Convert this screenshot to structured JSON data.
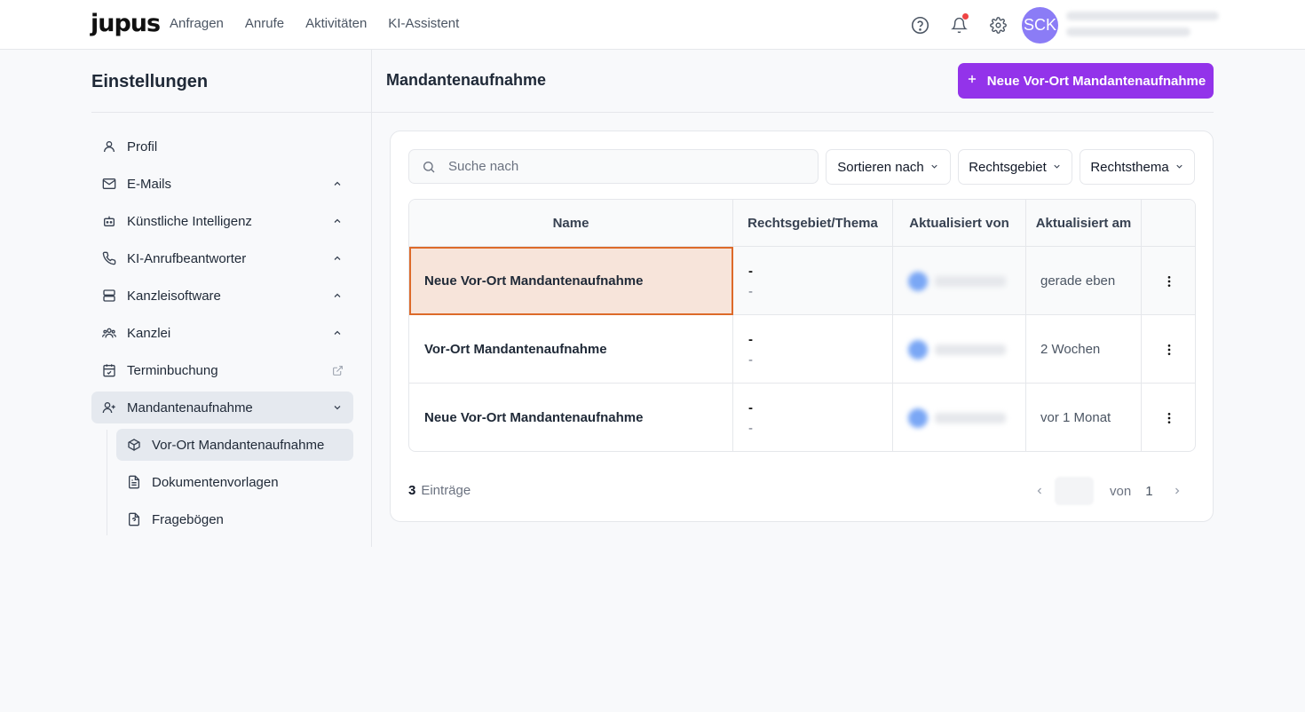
{
  "app": {
    "logo": "jupus"
  },
  "nav": {
    "items": [
      "Anfragen",
      "Anrufe",
      "Aktivitäten",
      "KI-Assistent"
    ]
  },
  "header": {
    "avatar_initials": "SCK"
  },
  "sidebar": {
    "title": "Einstellungen",
    "items": [
      {
        "label": "Profil",
        "icon": "user-icon"
      },
      {
        "label": "E-Mails",
        "icon": "mail-icon"
      },
      {
        "label": "Künstliche Intelligenz",
        "icon": "bot-icon"
      },
      {
        "label": "KI-Anrufbeantworter",
        "icon": "phone-icon"
      },
      {
        "label": "Kanzleisoftware",
        "icon": "server-icon"
      },
      {
        "label": "Kanzlei",
        "icon": "users-icon"
      },
      {
        "label": "Terminbuchung",
        "icon": "calendar-check-icon"
      },
      {
        "label": "Mandantenaufnahme",
        "icon": "user-plus-icon"
      }
    ],
    "subitems": [
      {
        "label": "Vor-Ort Mandantenaufnahme",
        "icon": "box-icon"
      },
      {
        "label": "Dokumentenvorlagen",
        "icon": "file-text-icon"
      },
      {
        "label": "Fragebögen",
        "icon": "file-question-icon"
      }
    ]
  },
  "main": {
    "title": "Mandantenaufnahme",
    "new_button_label": "Neue Vor-Ort Mandantenaufnahme",
    "search_placeholder": "Suche nach",
    "filters": [
      "Sortieren nach",
      "Rechtsgebiet",
      "Rechtsthema"
    ],
    "table": {
      "columns": [
        "Name",
        "Rechtsgebiet/Thema",
        "Aktualisiert von",
        "Aktualisiert am",
        ""
      ],
      "rows": [
        {
          "name": "Neue Vor-Ort Mandantenaufnahme",
          "area": "-",
          "topic": "-",
          "updated_at": "gerade eben"
        },
        {
          "name": "Vor-Ort Mandantenaufnahme",
          "area": "-",
          "topic": "-",
          "updated_at": "2 Wochen"
        },
        {
          "name": "Neue Vor-Ort Mandantenaufnahme",
          "area": "-",
          "topic": "-",
          "updated_at": "vor 1 Monat"
        }
      ]
    },
    "footer": {
      "count": "3",
      "count_label": "Einträge",
      "of_label": "von",
      "total_pages": "1"
    }
  },
  "colors": {
    "accent": "#9333ea",
    "highlight_border": "#dd6a2a",
    "highlight_bg": "#f7e4da",
    "notification": "#ef4444"
  }
}
